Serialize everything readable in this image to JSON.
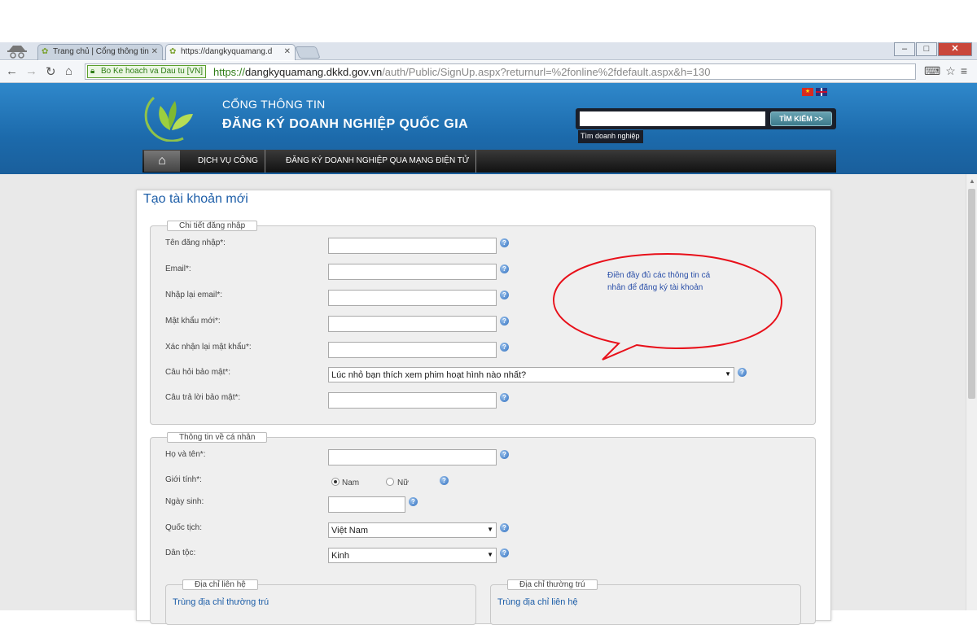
{
  "browser": {
    "tabs": [
      {
        "label": "Trang chủ | Cổng thông tin"
      },
      {
        "label": "https://dangkyquamang.d"
      }
    ],
    "ev_badge": "Bo Ke hoach va Dau tu [VN]",
    "url_scheme": "https://",
    "url_host": "dangkyquamang.dkkd.gov.vn",
    "url_path": "/auth/Public/SignUp.aspx?returnurl=%2fonline%2fdefault.aspx&h=130"
  },
  "header": {
    "brand_line1": "CỔNG THÔNG TIN",
    "brand_line2": "ĐĂNG KÝ DOANH NGHIỆP QUỐC GIA",
    "search_button": "TÌM KIẾM >>",
    "search_hint": "Tìm doanh nghiệp",
    "search_value": "",
    "nav": [
      "DỊCH VỤ CÔNG",
      "ĐĂNG KÝ DOANH NGHIỆP QUA MẠNG ĐIỆN TỬ"
    ]
  },
  "page": {
    "title": "Tạo tài khoản mới",
    "login_group": {
      "legend": "Chi tiết đăng nhập",
      "fields": [
        {
          "label": "Tên đăng nhập*:",
          "value": ""
        },
        {
          "label": "Email*:",
          "value": ""
        },
        {
          "label": "Nhập lại email*:",
          "value": ""
        },
        {
          "label": "Mật khẩu mới*:",
          "value": ""
        },
        {
          "label": "Xác nhận lại mật khẩu*:",
          "value": ""
        }
      ],
      "security_question": {
        "label": "Câu hỏi bảo mật*:",
        "value": "Lúc nhỏ bạn thích xem phim hoạt hình nào nhất?"
      },
      "security_answer": {
        "label": "Câu trả lời bảo mật*:",
        "value": ""
      }
    },
    "personal_group": {
      "legend": "Thông tin về cá nhân",
      "full_name": {
        "label": "Họ và tên*:",
        "value": ""
      },
      "gender": {
        "label": "Giới tính*:",
        "options": [
          "Nam",
          "Nữ"
        ],
        "selected": "Nam"
      },
      "dob": {
        "label": "Ngày sinh:",
        "value": ""
      },
      "nationality": {
        "label": "Quốc tịch:",
        "value": "Việt Nam"
      },
      "ethnicity": {
        "label": "Dân tộc:",
        "value": "Kinh"
      },
      "contact_address": {
        "legend": "Địa chỉ liên hệ",
        "link": "Trùng địa chỉ thường trú"
      },
      "permanent_address": {
        "legend": "Địa chỉ thường trú",
        "link": "Trùng địa chỉ liên hệ"
      }
    },
    "annotation": "Điền đầy đủ các thông tin cá nhân để đăng ký tài khoản"
  },
  "colors": {
    "header_blue": "#1c6aab",
    "title_blue": "#1d5ea8",
    "annotation_red": "#e8101a"
  }
}
